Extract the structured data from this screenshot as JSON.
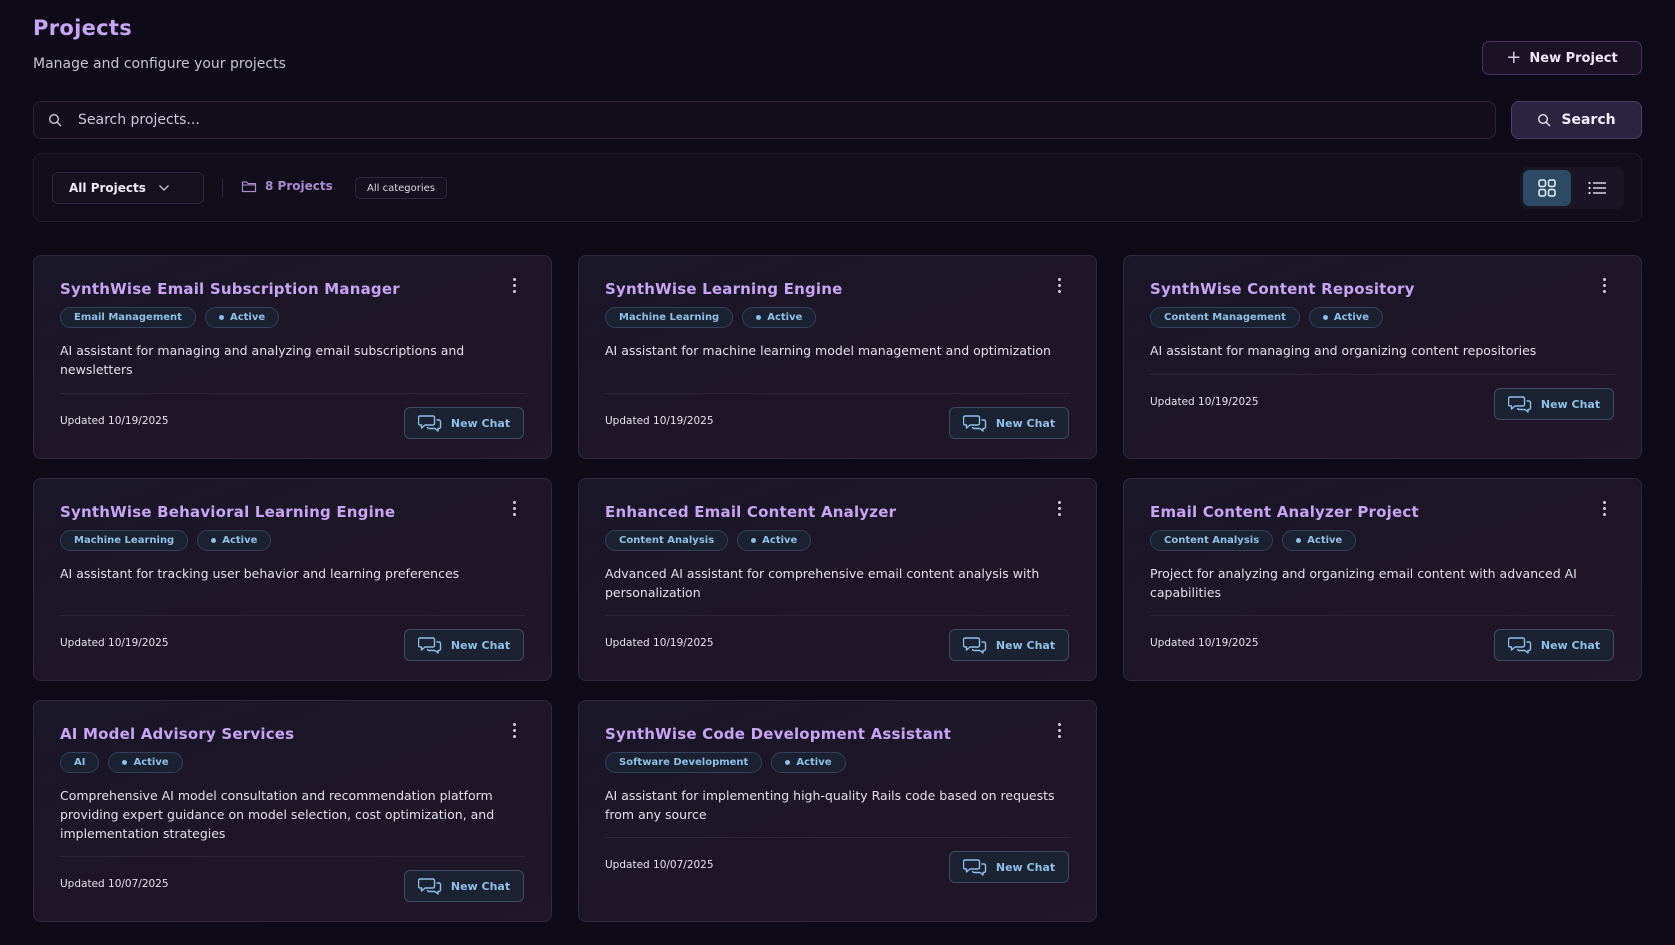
{
  "header": {
    "title": "Projects",
    "subtitle": "Manage and configure your projects",
    "new_project_label": "New Project"
  },
  "search": {
    "placeholder": "Search projects...",
    "value": "",
    "button_label": "Search"
  },
  "filters": {
    "project_filter_selected": "All Projects",
    "project_count": "8 Projects",
    "category_badge": "All categories",
    "active_view": "grid"
  },
  "projects": [
    {
      "title": "SynthWise Email Subscription Manager",
      "category": "Email Management",
      "status": "Active",
      "description": "AI assistant for managing and analyzing email subscriptions and newsletters",
      "updated": "Updated 10/19/2025",
      "chat_label": "New Chat"
    },
    {
      "title": "SynthWise Learning Engine",
      "category": "Machine Learning",
      "status": "Active",
      "description": "AI assistant for machine learning model management and optimization",
      "updated": "Updated 10/19/2025",
      "chat_label": "New Chat"
    },
    {
      "title": "SynthWise Content Repository",
      "category": "Content Management",
      "status": "Active",
      "description": "AI assistant for managing and organizing content repositories",
      "updated": "Updated 10/19/2025",
      "chat_label": "New Chat"
    },
    {
      "title": "SynthWise Behavioral Learning Engine",
      "category": "Machine Learning",
      "status": "Active",
      "description": "AI assistant for tracking user behavior and learning preferences",
      "updated": "Updated 10/19/2025",
      "chat_label": "New Chat"
    },
    {
      "title": "Enhanced Email Content Analyzer",
      "category": "Content Analysis",
      "status": "Active",
      "description": "Advanced AI assistant for comprehensive email content analysis with personalization",
      "updated": "Updated 10/19/2025",
      "chat_label": "New Chat"
    },
    {
      "title": "Email Content Analyzer Project",
      "category": "Content Analysis",
      "status": "Active",
      "description": "Project for analyzing and organizing email content with advanced AI capabilities",
      "updated": "Updated 10/19/2025",
      "chat_label": "New Chat"
    },
    {
      "title": "AI Model Advisory Services",
      "category": "AI",
      "status": "Active",
      "description": "Comprehensive AI model consultation and recommendation platform providing expert guidance on model selection, cost optimization, and implementation strategies",
      "updated": "Updated 10/07/2025",
      "chat_label": "New Chat"
    },
    {
      "title": "SynthWise Code Development Assistant",
      "category": "Software Development",
      "status": "Active",
      "description": "AI assistant for implementing high-quality Rails code based on requests from any source",
      "updated": "Updated 10/07/2025",
      "chat_label": "New Chat"
    }
  ],
  "colors": {
    "background": "#0f0a18",
    "accent_purple": "#c9a3f4",
    "tag_blue": "#8ec0e8",
    "active_view_bg": "#2c4a63"
  },
  "icons": {
    "new_project": "plus-icon",
    "search": "search-icon",
    "filter_dropdown": "chevron-down-icon",
    "project_count": "folder-icon",
    "grid_view": "grid-icon",
    "list_view": "list-icon",
    "card_menu": "more-vertical-icon",
    "chat": "chat-bubbles-icon"
  }
}
